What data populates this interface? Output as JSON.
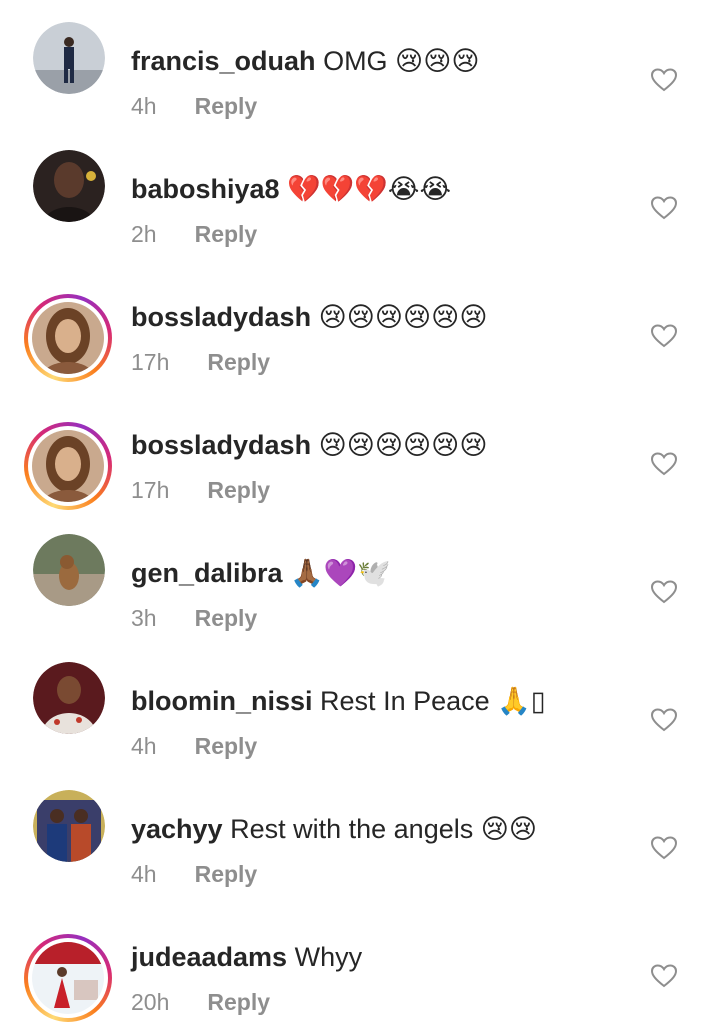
{
  "comments": [
    {
      "username": "francis_oduah",
      "text": "OMG 😢😢😢",
      "time": "4h",
      "reply": "Reply",
      "story": false
    },
    {
      "username": "baboshiya8",
      "text": "💔💔💔😭😭",
      "time": "2h",
      "reply": "Reply",
      "story": false
    },
    {
      "username": "bossladydash",
      "text": "😢😢😢😢😢😢",
      "time": "17h",
      "reply": "Reply",
      "story": true
    },
    {
      "username": "bossladydash",
      "text": "😢😢😢😢😢😢",
      "time": "17h",
      "reply": "Reply",
      "story": true
    },
    {
      "username": "gen_dalibra",
      "text": "🙏🏾💜🕊️",
      "time": "3h",
      "reply": "Reply",
      "story": false
    },
    {
      "username": "bloomin_nissi",
      "text": "Rest In Peace 🙏▯",
      "time": "4h",
      "reply": "Reply",
      "story": false
    },
    {
      "username": "yachyy",
      "text": "Rest with the angels 😢😢",
      "time": "4h",
      "reply": "Reply",
      "story": false
    },
    {
      "username": "judeaadams",
      "text": "Whyy",
      "time": "20h",
      "reply": "Reply",
      "story": true
    }
  ],
  "colors": {
    "text": "#262626",
    "secondary": "#8e8e8e",
    "story_ring": [
      "#feda75",
      "#fa7e1e",
      "#d62976",
      "#962fbf"
    ]
  },
  "icons": {
    "like": "heart-outline-icon"
  }
}
